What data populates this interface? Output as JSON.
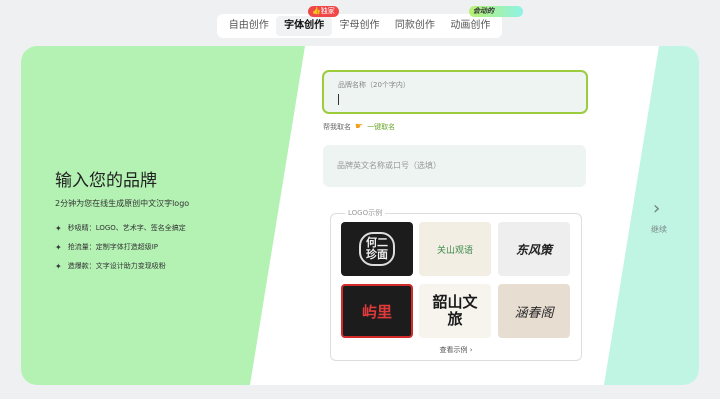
{
  "tabs": [
    {
      "label": "自由创作",
      "active": false
    },
    {
      "label": "字体创作",
      "active": true
    },
    {
      "label": "字母创作",
      "active": false
    },
    {
      "label": "同款创作",
      "active": false
    },
    {
      "label": "动画创作",
      "active": false
    }
  ],
  "badges": {
    "hot": "👍独家",
    "anim": "会动的"
  },
  "intro": {
    "heading": "输入您的品牌",
    "subtitle": "2分钟为您在线生成原创中文汉字logo",
    "features": [
      "秒吸睛：LOGO、艺术字、签名全搞定",
      "抢流量：定制字体打造超级IP",
      "造爆款：文字设计助力变现吸粉"
    ]
  },
  "form": {
    "brand_name_placeholder": "品牌名称（20个字内）",
    "brand_name_value": "",
    "helper_text": "帮我取名",
    "helper_link": "一键取名",
    "english_placeholder": "品牌英文名称或口号（选填）"
  },
  "gallery": {
    "title": "LOGO示例",
    "items": [
      "何二珍面",
      "关山观语",
      "东风策",
      "屿里",
      "韶山文旅",
      "涵春阁"
    ],
    "more": "查看示例 ›"
  },
  "next": {
    "arrow": "›",
    "label": "继续"
  },
  "colors": {
    "green_panel": "#b4f2b4",
    "mint_panel": "#c0f4e3",
    "accent": "#9ccc3c"
  }
}
